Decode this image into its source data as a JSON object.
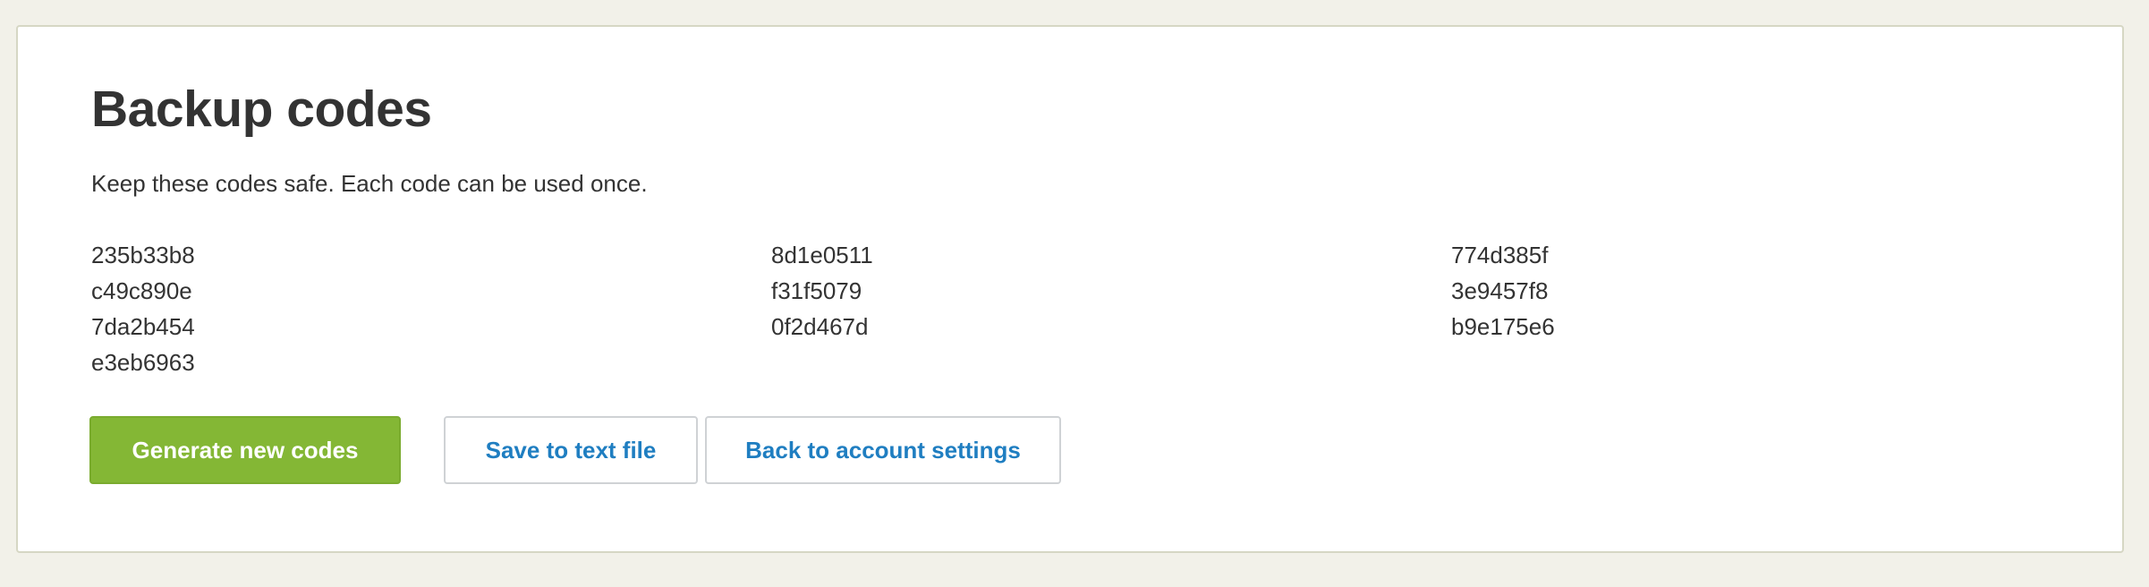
{
  "page": {
    "title": "Backup codes",
    "subtitle": "Keep these codes safe. Each code can be used once."
  },
  "codes": {
    "columns": [
      [
        "235b33b8",
        "c49c890e",
        "7da2b454",
        "e3eb6963"
      ],
      [
        "8d1e0511",
        "f31f5079",
        "0f2d467d"
      ],
      [
        "774d385f",
        "3e9457f8",
        "b9e175e6"
      ]
    ]
  },
  "actions": {
    "generate_label": "Generate new codes",
    "save_label": "Save to text file",
    "back_label": "Back to account settings"
  },
  "colors": {
    "page_background": "#f2f1e9",
    "primary_button": "#84b735",
    "link_text": "#1f7ec1",
    "text": "#333333"
  }
}
